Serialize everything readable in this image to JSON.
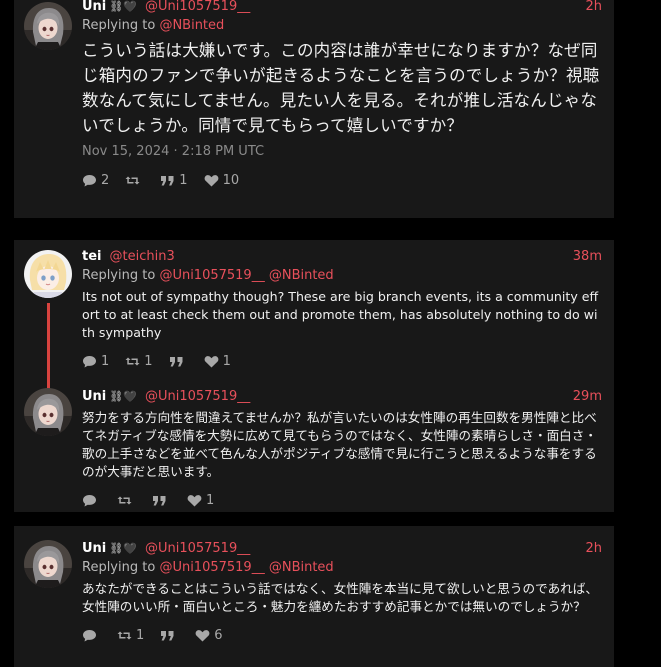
{
  "tweets": [
    {
      "name": "Uni",
      "badge": "⛓🖤",
      "handle": "@Uni1057519__",
      "time": "2h",
      "reply_prefix": "Replying to",
      "reply_to": "@NBinted",
      "text": "こういう話は大嫌いです。この内容は誰が幸せになりますか？なぜ同じ箱内のファンで争いが起きるようなことを言うのでしょうか？視聴数なんて気にしてません。見たい人を見る。それが推し活なんじゃないでしょうか。同情で見てもらって嬉しいですか？",
      "date": "Nov 15, 2024 · 2:18 PM UTC",
      "replies": "2",
      "retweets": "",
      "quotes": "1",
      "likes": "10"
    },
    {
      "name": "tei",
      "handle": "@teichin3",
      "time": "38m",
      "reply_prefix": "Replying to",
      "reply_to": "@Uni1057519__",
      "reply_to2": "@NBinted",
      "text": "Its not out of sympathy though? These are big branch events, its a community effort to at least check them out and promote them, has absolutely nothing to do with sympathy",
      "replies": "1",
      "retweets": "1",
      "quotes": "",
      "likes": "1"
    },
    {
      "name": "Uni",
      "badge": "⛓🖤",
      "handle": "@Uni1057519__",
      "time": "29m",
      "text": "努力をする方向性を間違えてませんか？私が言いたいのは女性陣の再生回数を男性陣と比べてネガティブな感情を大勢に広めて見てもらうのではなく、女性陣の素晴らしさ・面白さ・歌の上手さなどを並べて色んな人がポジティブな感情で見に行こうと思えるような事をするのが大事だと思います。",
      "replies": "",
      "retweets": "",
      "quotes": "",
      "likes": "1"
    },
    {
      "name": "Uni",
      "badge": "⛓🖤",
      "handle": "@Uni1057519__",
      "time": "2h",
      "reply_prefix": "Replying to",
      "reply_to": "@Uni1057519__",
      "reply_to2": "@NBinted",
      "text": "あなたができることはこういう話ではなく、女性陣を本当に見て欲しいと思うのであれば、女性陣のいい所・面白いところ・魅力を纏めたおすすめ記事とかでは無いのでしょうか？",
      "replies": "",
      "retweets": "1",
      "quotes": "",
      "likes": "6"
    }
  ]
}
